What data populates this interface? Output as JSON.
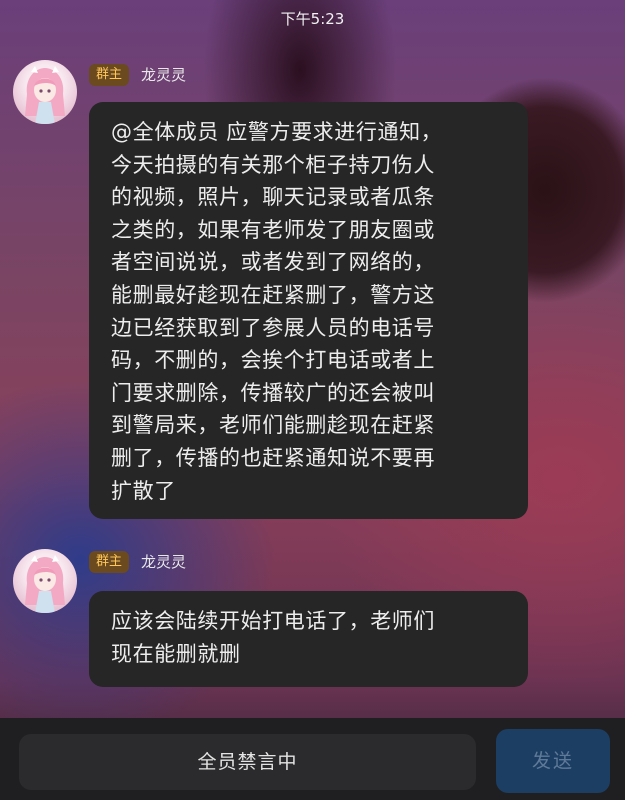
{
  "status_bar": {
    "time": "下午5:23"
  },
  "messages": [
    {
      "badge": "群主",
      "sender": "龙灵灵",
      "text": "@全体成员 应警方要求进行通知，\n今天拍摄的有关那个柜子持刀伤人\n的视频，照片，聊天记录或者瓜条\n之类的，如果有老师发了朋友圈或\n者空间说说，或者发到了网络的，\n能删最好趁现在赶紧删了，警方这\n边已经获取到了参展人员的电话号\n码，不删的，会挨个打电话或者上\n门要求删除，传播较广的还会被叫\n到警局来，老师们能删趁现在赶紧\n删了，传播的也赶紧通知说不要再\n扩散了"
    },
    {
      "badge": "群主",
      "sender": "龙灵灵",
      "text": "应该会陆续开始打电话了，老师们\n现在能删就删"
    }
  ],
  "input_bar": {
    "mute_label": "全员禁言中",
    "send_label": "发送"
  }
}
